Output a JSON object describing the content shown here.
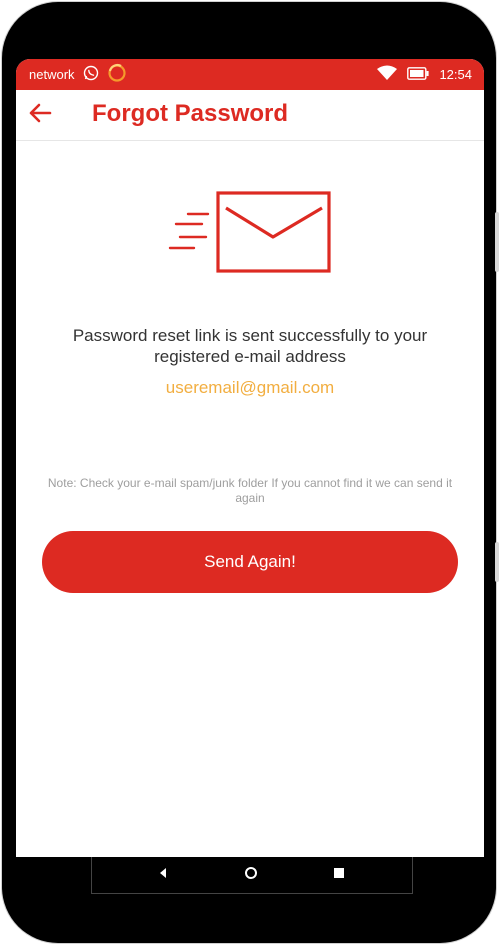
{
  "status_bar": {
    "carrier": "network",
    "time": "12:54",
    "icons": [
      "whatsapp-icon",
      "notification-ring-icon",
      "wifi-icon",
      "battery-icon"
    ]
  },
  "app_bar": {
    "title": "Forgot Password",
    "back_icon": "arrow-left-icon"
  },
  "illustration": {
    "icon": "mail-sent-icon"
  },
  "content": {
    "message": "Password reset link is sent successfully to your registered e-mail address",
    "email": "useremail@gmail.com",
    "note": "Note: Check your e-mail spam/junk folder If you cannot find it we can send it again"
  },
  "actions": {
    "send_again_label": "Send Again!"
  },
  "nav_bar": {
    "icons": [
      "back-triangle-icon",
      "home-circle-icon",
      "recents-square-icon"
    ]
  },
  "colors": {
    "accent": "#dd2a22",
    "email": "#f2ae40",
    "text": "#333333",
    "note": "#9e9e9e"
  }
}
